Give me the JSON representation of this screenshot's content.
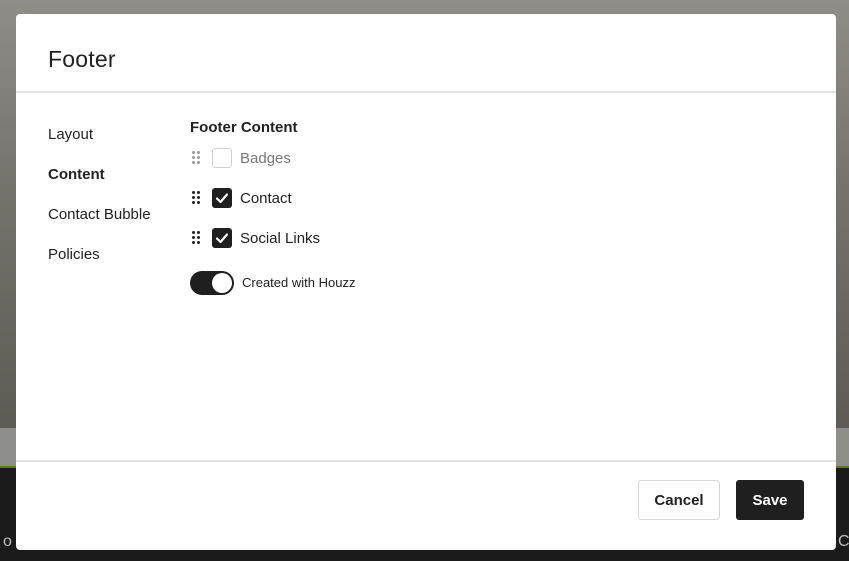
{
  "backdrop": {
    "left_glyph": "o",
    "right_glyph": "C"
  },
  "modal": {
    "title": "Footer",
    "sidebar": {
      "items": [
        {
          "label": "Layout",
          "active": false
        },
        {
          "label": "Content",
          "active": true
        },
        {
          "label": "Contact Bubble",
          "active": false
        },
        {
          "label": "Policies",
          "active": false
        }
      ]
    },
    "content": {
      "section_title": "Footer Content",
      "items": [
        {
          "label": "Badges",
          "checked": false
        },
        {
          "label": "Contact",
          "checked": true
        },
        {
          "label": "Social Links",
          "checked": true
        }
      ],
      "toggle": {
        "label": "Created with Houzz",
        "on": true
      }
    },
    "footer": {
      "cancel_label": "Cancel",
      "save_label": "Save"
    }
  },
  "colors": {
    "primary": "#1f1f1f",
    "border": "#e2e2e2",
    "accent_green": "#5a7a2e"
  }
}
